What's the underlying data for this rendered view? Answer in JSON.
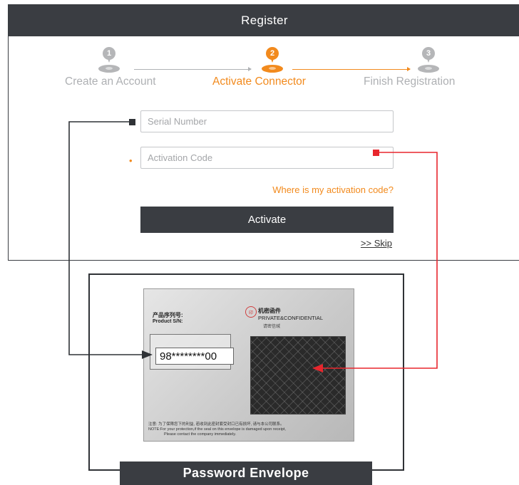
{
  "header": {
    "title": "Register"
  },
  "steps": [
    {
      "number": "1",
      "label": "Create an Account",
      "state": "inactive"
    },
    {
      "number": "2",
      "label": "Activate Connector",
      "state": "active"
    },
    {
      "number": "3",
      "label": "Finish Registration",
      "state": "inactive"
    }
  ],
  "form": {
    "serial_placeholder": "Serial Number",
    "serial_value": "",
    "activation_placeholder": "Activation Code",
    "activation_value": "",
    "required_mark": "•",
    "where_link": "Where is my activation code?",
    "activate_label": "Activate",
    "skip_label": ">> Skip"
  },
  "envelope": {
    "product_sn_cn": "产品序列号:",
    "product_sn_en": "Product S/N:",
    "serial_value": "98********00",
    "confidential_cn": "机密函件",
    "confidential_en": "PRIVATE&CONFIDENTIAL",
    "confidential_cn2": "请密信缄",
    "notice_cn": "注意: 为了保障您下的利益, 若收到此密封套受封口已有损坏, 请与本公司联系。",
    "notice_en": "NOTE:For your protection,if the seal on this envelope is damaged upon receipt,",
    "notice_en2": "Please contact the company immediately.",
    "caption": "Password Envelope"
  },
  "colors": {
    "dark": "#3a3d42",
    "accent": "#f28a1d",
    "inactive": "#b5b6b8",
    "connector_dark": "#2f3236",
    "connector_red": "#e8262d"
  },
  "icons": {
    "step_marker": "map-pin-icon"
  }
}
